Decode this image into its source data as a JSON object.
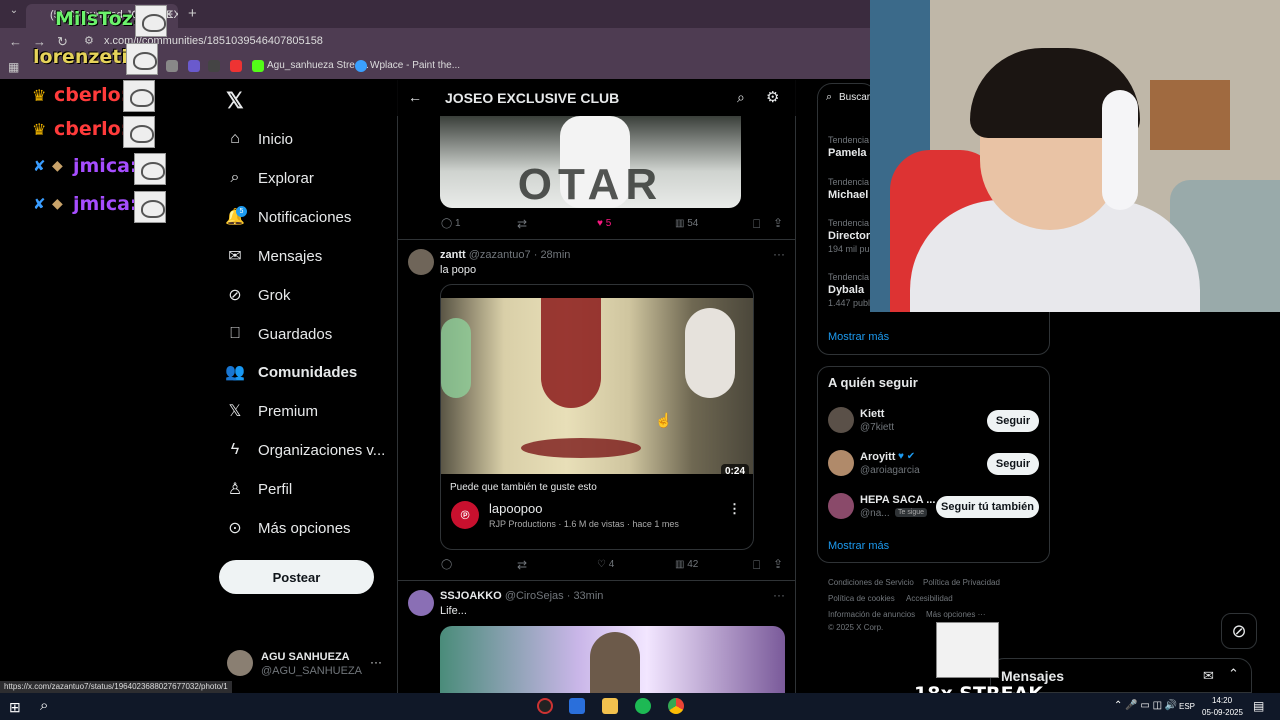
{
  "browser": {
    "tab_title": "(5) Comunidad JOSEO EX...",
    "url": "x.com/i/communities/1851039546407805158",
    "status_url": "https://x.com/zazantuo7/status/1964023688027677032/photo/1",
    "bookmarks": [
      "Agu_sanhueza Strea...",
      "Wplace - Paint the..."
    ]
  },
  "chat": [
    {
      "user": "MilsToz:",
      "color": "#6cf26c"
    },
    {
      "user": "lorenzeti:",
      "color": "#e6d35a"
    },
    {
      "user": "cberlo:",
      "color": "#ff3b3b"
    },
    {
      "user": "cberlo:",
      "color": "#ff3b3b"
    },
    {
      "user": "jmica:",
      "color": "#a64dff"
    },
    {
      "user": "jmica:",
      "color": "#a64dff"
    }
  ],
  "nav": {
    "items": [
      {
        "label": "Inicio",
        "icon": "home-icon"
      },
      {
        "label": "Explorar",
        "icon": "search-icon"
      },
      {
        "label": "Notificaciones",
        "icon": "bell-icon"
      },
      {
        "label": "Mensajes",
        "icon": "mail-icon"
      },
      {
        "label": "Grok",
        "icon": "grok-icon"
      },
      {
        "label": "Guardados",
        "icon": "bookmark-icon"
      },
      {
        "label": "Comunidades",
        "icon": "people-icon"
      },
      {
        "label": "Premium",
        "icon": "x-logo-icon"
      },
      {
        "label": "Organizaciones v...",
        "icon": "lightning-icon"
      },
      {
        "label": "Perfil",
        "icon": "person-icon"
      },
      {
        "label": "Más opciones",
        "icon": "more-circle-icon"
      }
    ],
    "notif_badge": "5",
    "post_label": "Postear",
    "account_name": "AGU SANHUEZA",
    "account_handle": "@AGU_SANHUEZA"
  },
  "community": {
    "title": "JOSEO EXCLUSIVE CLUB"
  },
  "top_post": {
    "banner_text": "OTAR",
    "replies": "1",
    "likes": "5",
    "views": "54"
  },
  "post1": {
    "name": "zantt",
    "handle": "@zazantuo7 · 28min",
    "text": "la popo",
    "duration": "0:24",
    "suggest_label": "Puede que también te guste esto",
    "suggest_title": "lapoopoo",
    "suggest_meta": "RJP Productions · 1.6 M de vistas · hace 1 mes",
    "likes": "4",
    "views": "42"
  },
  "post2": {
    "name": "SSJOAKKO",
    "handle": "@CiroSejas · 33min",
    "text": "Life..."
  },
  "search": {
    "placeholder": "Buscar"
  },
  "trends": {
    "items": [
      {
        "meta": "Tendencia",
        "name": "Pamela J",
        "count": ""
      },
      {
        "meta": "Tendencia",
        "name": "Michael",
        "count": ""
      },
      {
        "meta": "Tendencia",
        "name": "Director",
        "count": "194 mil pu"
      },
      {
        "meta": "Tendencia",
        "name": "Dybala",
        "count": "1.447 publ"
      }
    ],
    "show_more": "Mostrar más"
  },
  "who_to_follow": {
    "title": "A quién seguir",
    "users": [
      {
        "name": "Kiett",
        "handle": "@7kiett",
        "button": "Seguir",
        "tag": ""
      },
      {
        "name": "Aroyitt",
        "handle": "@aroiagarcia",
        "button": "Seguir",
        "tag": ""
      },
      {
        "name": "HEPA SACA ...",
        "handle": "@na...",
        "button": "Seguir tú también",
        "tag": "Te sigue"
      }
    ],
    "show_more": "Mostrar más"
  },
  "footer": {
    "links": [
      "Condiciones de Servicio",
      "Política de Privacidad",
      "Política de cookies",
      "Accesibilidad",
      "Información de anuncios",
      "Más opciones ···"
    ],
    "copyright": "© 2025 X Corp."
  },
  "messages_label": "Mensajes",
  "streak_label": "18x STREAK",
  "taskbar": {
    "lang": "ESP",
    "time": "14:20",
    "date": "05-09-2025"
  },
  "colors": {
    "accent": "#1d9bf0",
    "like": "#f91880",
    "bg": "#000000"
  }
}
